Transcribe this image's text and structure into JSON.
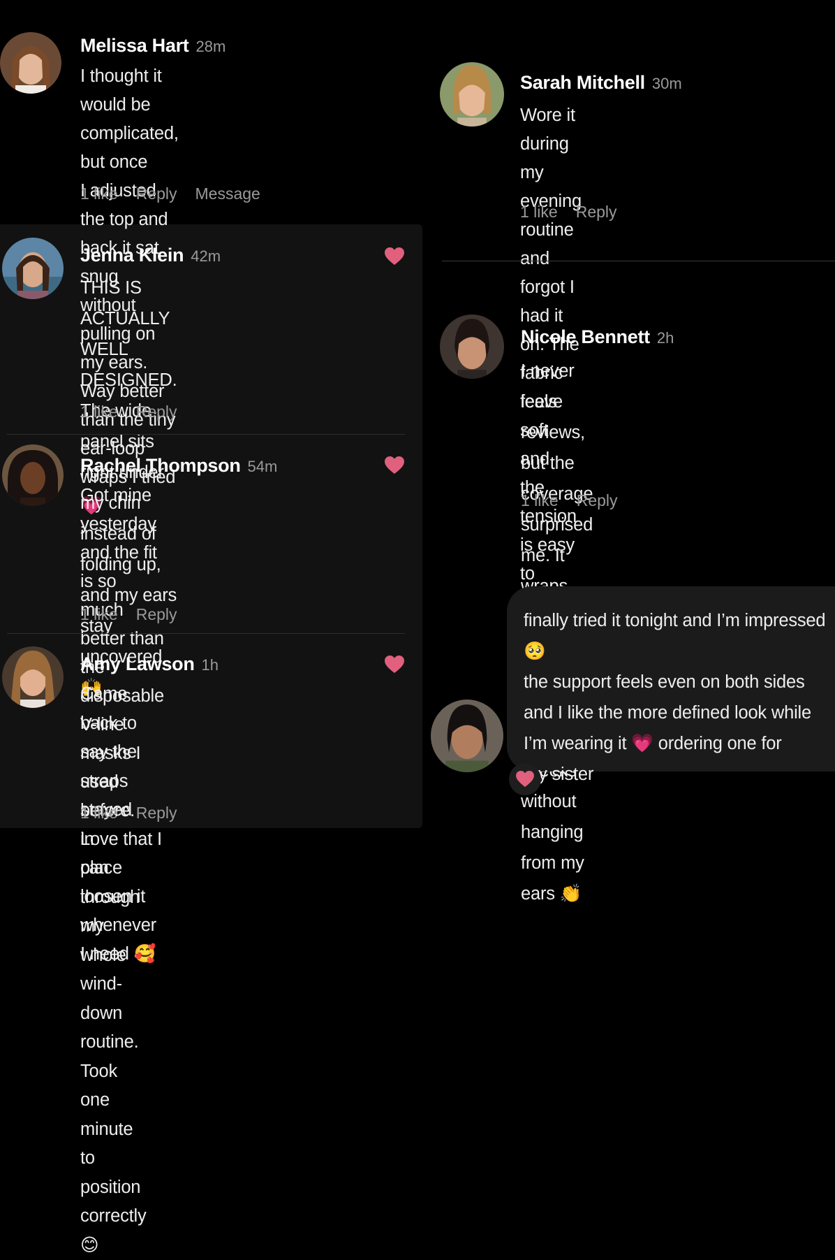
{
  "comments": [
    {
      "name": "Melissa Hart",
      "time": "28m",
      "lines": [
        "I thought it would be complicated, but once",
        "I adjusted the top and back it sat snug",
        "without pulling on my ears. Way better",
        "than the tiny ear-loop wraps I tried 💗"
      ],
      "likes": "1 like",
      "reply": "Reply",
      "message": "Message"
    },
    {
      "name": "Jenna Klein",
      "time": "42m",
      "lines": [
        "THIS IS ACTUALLY WELL DESIGNED.",
        "The wide panel sits right under my chin",
        "instead of folding up, and my ears stay",
        "uncovered 🙌"
      ],
      "likes": "1 like",
      "reply": "Reply"
    },
    {
      "name": "Rachel Thompson",
      "time": "54m",
      "lines": [
        "Got mine yesterday and the fit is so",
        "much better than the disposable V-line",
        "masks I used before. Love that I can",
        "loosen it whenever I need 🥰"
      ],
      "likes": "1 like",
      "reply": "Reply"
    },
    {
      "name": "Amy Lawson",
      "time": "1h",
      "lines": [
        "Came back to say the straps stayed in",
        "place through my whole wind-down",
        "routine. Took one minute to position",
        "correctly 😊"
      ],
      "likes": "1 like",
      "reply": "Reply"
    },
    {
      "name": "Sarah Mitchell",
      "time": "30m",
      "lines": [
        "Wore it during my evening routine and",
        "forgot I had it on. The fabric feels soft and",
        "the tension is easy to control ✨"
      ],
      "likes": "1 like",
      "reply": "Reply"
    },
    {
      "name": "Nicole Bennett",
      "time": "2h",
      "lines": [
        "I never leave reviews, but the coverage",
        "surprised me. It wraps under my chin",
        "and along my lower cheeks without",
        "hanging from my ears 👏"
      ],
      "likes": "1 like",
      "reply": "Reply"
    }
  ],
  "message_bubble": {
    "lines": [
      "finally tried it tonight and I’m impressed 🥺",
      "the support feels even on both sides",
      "and I like the more defined look while",
      "I’m wearing it 💗 ordering one for",
      "my sister"
    ]
  },
  "colors": {
    "background": "#000000",
    "panel": "#121212",
    "heart": "#e0607e",
    "muted_text": "#9a9a9a"
  },
  "icons": {
    "like": "heart-icon"
  }
}
